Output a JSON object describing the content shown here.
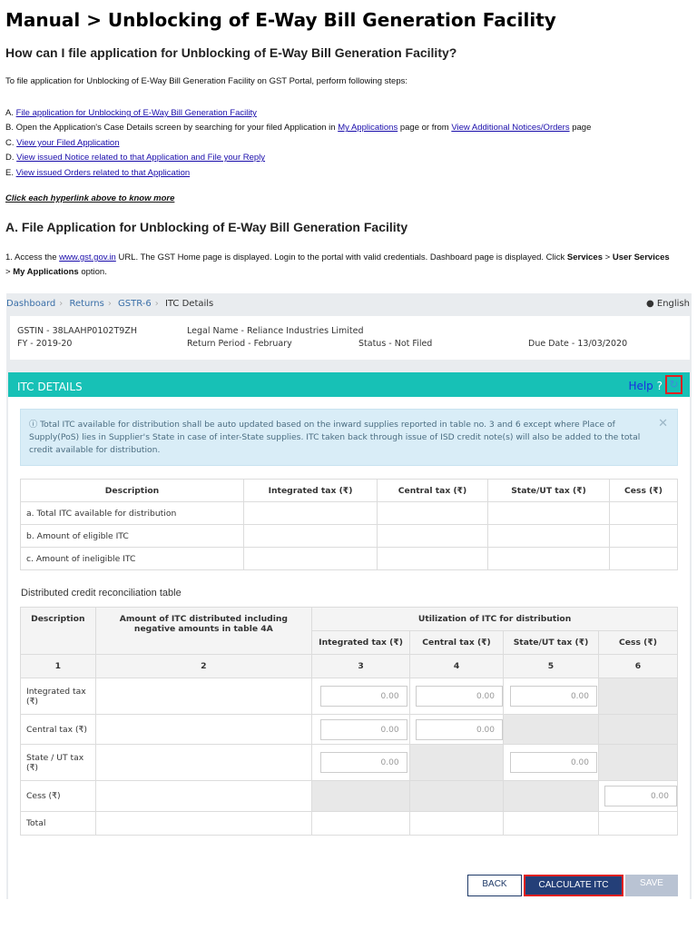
{
  "title": "Manual > Unblocking of E-Way Bill Generation Facility",
  "question": "How can I file application for Unblocking of E-Way Bill Generation Facility?",
  "intro": "To file application for Unblocking of E-Way Bill Generation Facility on GST Portal, perform following steps:",
  "steps": {
    "a_prefix": "A. ",
    "a_link": "File application for Unblocking of E-Way Bill Generation Facility",
    "b_prefix": "B. Open the Application's Case Details screen by searching for your filed Application in ",
    "b_link1": "My Applications",
    "b_mid": " page or from ",
    "b_link2": "View Additional Notices/Orders",
    "b_suffix": " page",
    "c_prefix": "C. ",
    "c_link": "View your Filed Application",
    "d_prefix": "D. ",
    "d_link": "View issued Notice related to that Application and File your Reply",
    "e_prefix": "E. ",
    "e_link": "View issued Orders related to that Application"
  },
  "click_note": "Click each hyperlink above to know more",
  "section_a": "A. File Application for Unblocking of E-Way Bill Generation Facility",
  "access": {
    "p1": "1. Access the ",
    "link": "www.gst.gov.in",
    "p2": " URL. The GST Home page is displayed. Login to the portal with valid credentials. Dashboard page is displayed. Click ",
    "b1": "Services",
    "p3": " > ",
    "b2": "User Services",
    "p4": "> ",
    "b3": "My Applications",
    "p5": " option."
  },
  "portal": {
    "breadcrumb": [
      "Dashboard",
      "Returns",
      "GSTR-6",
      "ITC Details"
    ],
    "language": "English",
    "gstin": "GSTIN - 38LAAHP0102T9ZH",
    "legal_name": "Legal Name - Reliance Industries Limited",
    "fy": "FY - 2019-20",
    "return_period": "Return Period - February",
    "status": "Status - Not Filed",
    "due_date": "Due Date - 13/03/2020",
    "section_title": "ITC DETAILS",
    "help": "Help",
    "alert": "Total ITC available for distribution shall be auto updated based on the inward supplies reported in table no. 3 and 6 except where Place of Supply(PoS) lies in Supplier's State in case of inter-State supplies. ITC taken back through issue of ISD credit note(s) will also be added to the total credit available for distribution.",
    "table1": {
      "headers": [
        "Description",
        "Integrated tax (₹)",
        "Central tax (₹)",
        "State/UT tax (₹)",
        "Cess (₹)"
      ],
      "rows": [
        "a. Total ITC available for distribution",
        "b. Amount of eligible ITC",
        "c. Amount of ineligible ITC"
      ]
    },
    "recon_title": "Distributed credit reconciliation table",
    "table2": {
      "h_desc": "Description",
      "h_amount": "Amount of ITC distributed including negative amounts in table 4A",
      "h_util": "Utilization of ITC for distribution",
      "sub": [
        "Integrated tax (₹)",
        "Central tax (₹)",
        "State/UT tax (₹)",
        "Cess (₹)"
      ],
      "nums": [
        "1",
        "2",
        "3",
        "4",
        "5",
        "6"
      ],
      "rows": [
        "Integrated tax (₹)",
        "Central tax (₹)",
        "State / UT tax (₹)",
        "Cess (₹)",
        "Total"
      ],
      "value": "0.00"
    },
    "buttons": {
      "back": "BACK",
      "calculate": "CALCULATE ITC",
      "save": "SAVE"
    }
  }
}
